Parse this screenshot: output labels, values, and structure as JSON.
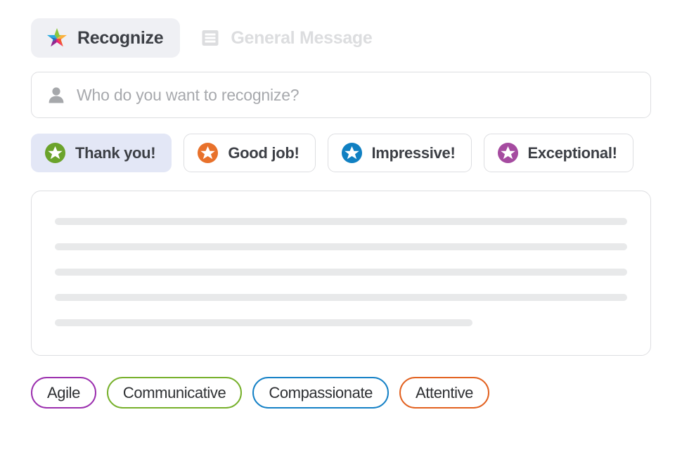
{
  "tabs": [
    {
      "label": "Recognize",
      "icon": "multicolor-star-icon",
      "active": true
    },
    {
      "label": "General Message",
      "icon": "message-lines-icon",
      "active": false
    }
  ],
  "recipient": {
    "icon": "person-icon",
    "placeholder": "Who do you want to recognize?",
    "value": ""
  },
  "sentiments": [
    {
      "label": "Thank you!",
      "icon": "star-badge-icon",
      "color": "#6ba32b",
      "selected": true
    },
    {
      "label": "Good job!",
      "icon": "star-badge-icon",
      "color": "#e8712b",
      "selected": false
    },
    {
      "label": "Impressive!",
      "icon": "star-badge-icon",
      "color": "#1080c2",
      "selected": false
    },
    {
      "label": "Exceptional!",
      "icon": "star-badge-icon",
      "color": "#a54ba0",
      "selected": false
    }
  ],
  "message_body": {
    "placeholder_lines": [
      100,
      100,
      100,
      100,
      73
    ]
  },
  "traits": [
    {
      "label": "Agile",
      "color": "#9b2fae"
    },
    {
      "label": "Communicative",
      "color": "#76b02a"
    },
    {
      "label": "Compassionate",
      "color": "#1581c6"
    },
    {
      "label": "Attentive",
      "color": "#e2611f"
    }
  ],
  "theme": {
    "selected_chip_bg": "#e3e7f6",
    "active_tab_bg": "#eff0f4",
    "border": "#dddee1",
    "text": "#3c3f45",
    "muted_text": "#a7a9ad",
    "skeleton": "#e8e9ea"
  }
}
